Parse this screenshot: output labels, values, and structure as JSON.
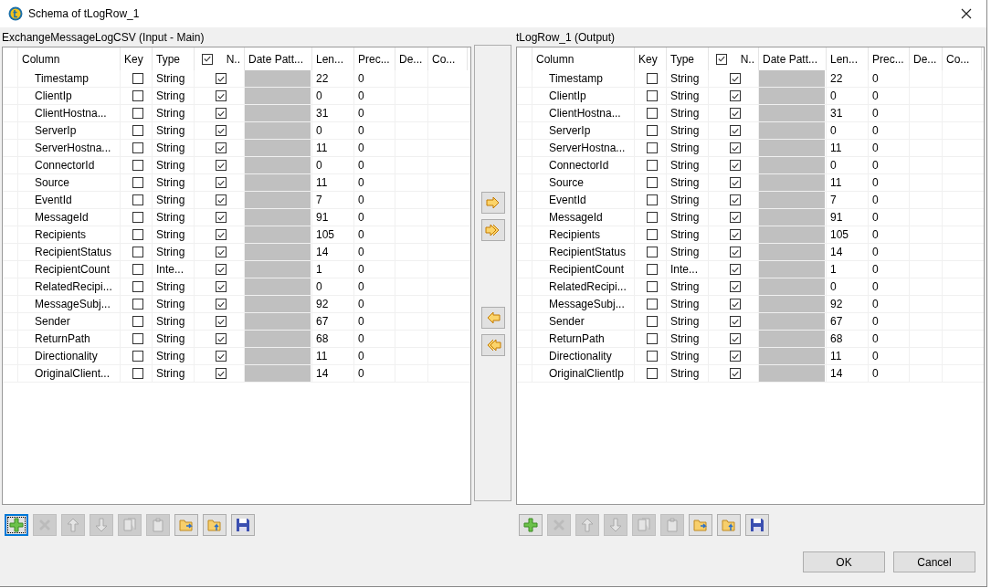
{
  "window": {
    "title": "Schema of tLogRow_1"
  },
  "panels": [
    {
      "title": "ExchangeMessageLogCSV (Input - Main)",
      "columns": [
        "Column",
        "Key",
        "Type",
        "N..",
        "Date Patt...",
        "Len...",
        "Prec...",
        "De...",
        "Co..."
      ],
      "nullable_header_checked": true,
      "rows": [
        {
          "name": "Timestamp",
          "key": false,
          "type": "String",
          "nullable": true,
          "length": "22",
          "precision": "0"
        },
        {
          "name": "ClientIp",
          "key": false,
          "type": "String",
          "nullable": true,
          "length": "0",
          "precision": "0"
        },
        {
          "name": "ClientHostna...",
          "key": false,
          "type": "String",
          "nullable": true,
          "length": "31",
          "precision": "0"
        },
        {
          "name": "ServerIp",
          "key": false,
          "type": "String",
          "nullable": true,
          "length": "0",
          "precision": "0"
        },
        {
          "name": "ServerHostna...",
          "key": false,
          "type": "String",
          "nullable": true,
          "length": "11",
          "precision": "0"
        },
        {
          "name": "ConnectorId",
          "key": false,
          "type": "String",
          "nullable": true,
          "length": "0",
          "precision": "0"
        },
        {
          "name": "Source",
          "key": false,
          "type": "String",
          "nullable": true,
          "length": "11",
          "precision": "0"
        },
        {
          "name": "EventId",
          "key": false,
          "type": "String",
          "nullable": true,
          "length": "7",
          "precision": "0"
        },
        {
          "name": "MessageId",
          "key": false,
          "type": "String",
          "nullable": true,
          "length": "91",
          "precision": "0"
        },
        {
          "name": "Recipients",
          "key": false,
          "type": "String",
          "nullable": true,
          "length": "105",
          "precision": "0"
        },
        {
          "name": "RecipientStatus",
          "key": false,
          "type": "String",
          "nullable": true,
          "length": "14",
          "precision": "0"
        },
        {
          "name": "RecipientCount",
          "key": false,
          "type": "Inte...",
          "nullable": true,
          "length": "1",
          "precision": "0"
        },
        {
          "name": "RelatedRecipi...",
          "key": false,
          "type": "String",
          "nullable": true,
          "length": "0",
          "precision": "0"
        },
        {
          "name": "MessageSubj...",
          "key": false,
          "type": "String",
          "nullable": true,
          "length": "92",
          "precision": "0"
        },
        {
          "name": "Sender",
          "key": false,
          "type": "String",
          "nullable": true,
          "length": "67",
          "precision": "0"
        },
        {
          "name": "ReturnPath",
          "key": false,
          "type": "String",
          "nullable": true,
          "length": "68",
          "precision": "0"
        },
        {
          "name": "Directionality",
          "key": false,
          "type": "String",
          "nullable": true,
          "length": "11",
          "precision": "0"
        },
        {
          "name": "OriginalClient...",
          "key": false,
          "type": "String",
          "nullable": true,
          "length": "14",
          "precision": "0"
        }
      ],
      "toolbar": [
        {
          "kind": "add",
          "disabled": false,
          "focused": true
        },
        {
          "kind": "delete",
          "disabled": true,
          "focused": false
        },
        {
          "kind": "up",
          "disabled": true,
          "focused": false
        },
        {
          "kind": "down",
          "disabled": true,
          "focused": false
        },
        {
          "kind": "copy",
          "disabled": true,
          "focused": false
        },
        {
          "kind": "paste",
          "disabled": true,
          "focused": false
        },
        {
          "kind": "import",
          "disabled": false,
          "focused": false
        },
        {
          "kind": "export",
          "disabled": false,
          "focused": false
        },
        {
          "kind": "save",
          "disabled": false,
          "focused": false
        }
      ]
    },
    {
      "title": "tLogRow_1 (Output)",
      "columns": [
        "Column",
        "Key",
        "Type",
        "N..",
        "Date Patt...",
        "Len...",
        "Prec...",
        "De...",
        "Co..."
      ],
      "nullable_header_checked": true,
      "rows": [
        {
          "name": "Timestamp",
          "key": false,
          "type": "String",
          "nullable": true,
          "length": "22",
          "precision": "0"
        },
        {
          "name": "ClientIp",
          "key": false,
          "type": "String",
          "nullable": true,
          "length": "0",
          "precision": "0"
        },
        {
          "name": "ClientHostna...",
          "key": false,
          "type": "String",
          "nullable": true,
          "length": "31",
          "precision": "0"
        },
        {
          "name": "ServerIp",
          "key": false,
          "type": "String",
          "nullable": true,
          "length": "0",
          "precision": "0"
        },
        {
          "name": "ServerHostna...",
          "key": false,
          "type": "String",
          "nullable": true,
          "length": "11",
          "precision": "0"
        },
        {
          "name": "ConnectorId",
          "key": false,
          "type": "String",
          "nullable": true,
          "length": "0",
          "precision": "0"
        },
        {
          "name": "Source",
          "key": false,
          "type": "String",
          "nullable": true,
          "length": "11",
          "precision": "0"
        },
        {
          "name": "EventId",
          "key": false,
          "type": "String",
          "nullable": true,
          "length": "7",
          "precision": "0"
        },
        {
          "name": "MessageId",
          "key": false,
          "type": "String",
          "nullable": true,
          "length": "91",
          "precision": "0"
        },
        {
          "name": "Recipients",
          "key": false,
          "type": "String",
          "nullable": true,
          "length": "105",
          "precision": "0"
        },
        {
          "name": "RecipientStatus",
          "key": false,
          "type": "String",
          "nullable": true,
          "length": "14",
          "precision": "0"
        },
        {
          "name": "RecipientCount",
          "key": false,
          "type": "Inte...",
          "nullable": true,
          "length": "1",
          "precision": "0"
        },
        {
          "name": "RelatedRecipi...",
          "key": false,
          "type": "String",
          "nullable": true,
          "length": "0",
          "precision": "0"
        },
        {
          "name": "MessageSubj...",
          "key": false,
          "type": "String",
          "nullable": true,
          "length": "92",
          "precision": "0"
        },
        {
          "name": "Sender",
          "key": false,
          "type": "String",
          "nullable": true,
          "length": "67",
          "precision": "0"
        },
        {
          "name": "ReturnPath",
          "key": false,
          "type": "String",
          "nullable": true,
          "length": "68",
          "precision": "0"
        },
        {
          "name": "Directionality",
          "key": false,
          "type": "String",
          "nullable": true,
          "length": "11",
          "precision": "0"
        },
        {
          "name": "OriginalClientIp",
          "key": false,
          "type": "String",
          "nullable": true,
          "length": "14",
          "precision": "0"
        }
      ],
      "toolbar": [
        {
          "kind": "add",
          "disabled": false,
          "focused": false
        },
        {
          "kind": "delete",
          "disabled": true,
          "focused": false
        },
        {
          "kind": "up",
          "disabled": true,
          "focused": false
        },
        {
          "kind": "down",
          "disabled": true,
          "focused": false
        },
        {
          "kind": "copy",
          "disabled": true,
          "focused": false
        },
        {
          "kind": "paste",
          "disabled": true,
          "focused": false
        },
        {
          "kind": "import",
          "disabled": false,
          "focused": false
        },
        {
          "kind": "export",
          "disabled": false,
          "focused": false
        },
        {
          "kind": "save",
          "disabled": false,
          "focused": false
        }
      ]
    }
  ],
  "transfer_buttons": [
    {
      "kind": "copy-one-right"
    },
    {
      "kind": "copy-all-right"
    },
    {
      "kind": "copy-one-left"
    },
    {
      "kind": "copy-all-left"
    }
  ],
  "buttons": [
    "OK",
    "Cancel"
  ]
}
